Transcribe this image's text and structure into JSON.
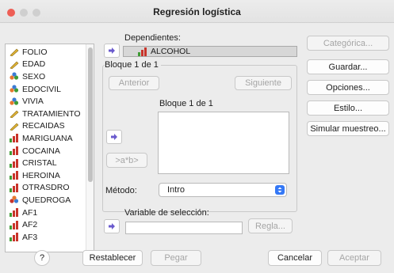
{
  "window": {
    "title": "Regresión logística",
    "controls": {
      "close": "#ee5e55",
      "minimize": "#f5be4f",
      "zoom": "#59c13f"
    }
  },
  "variables": [
    {
      "label": "FOLIO",
      "type": "scale"
    },
    {
      "label": "EDAD",
      "type": "scale"
    },
    {
      "label": "SEXO",
      "type": "nominal"
    },
    {
      "label": "EDOCIVIL",
      "type": "nominal"
    },
    {
      "label": "VIVIA",
      "type": "nominal"
    },
    {
      "label": "TRATAMIENTO",
      "type": "scale"
    },
    {
      "label": "RECAIDAS",
      "type": "scale"
    },
    {
      "label": "MARIGUANA",
      "type": "ordinal"
    },
    {
      "label": "COCAINA",
      "type": "ordinal"
    },
    {
      "label": "CRISTAL",
      "type": "ordinal"
    },
    {
      "label": "HEROINA",
      "type": "ordinal"
    },
    {
      "label": "OTRASDRO",
      "type": "ordinal"
    },
    {
      "label": "QUEDROGA",
      "type": "nominal-alt"
    },
    {
      "label": "AF1",
      "type": "ordinal"
    },
    {
      "label": "AF2",
      "type": "ordinal"
    },
    {
      "label": "AF3",
      "type": "ordinal"
    }
  ],
  "dependent": {
    "label": "Dependientes:",
    "value": "ALCOHOL",
    "value_icon": "ordinal"
  },
  "block": {
    "header": "Bloque 1 de 1",
    "prev_label": "Anterior",
    "next_label": "Siguiente",
    "inner_label": "Bloque 1 de 1",
    "interaction_label": ">a*b>"
  },
  "method": {
    "label": "Método:",
    "value": "Intro"
  },
  "selection": {
    "label": "Variable de selección:",
    "rule_label": "Regla..."
  },
  "side_buttons": {
    "categoria": "Categórica...",
    "guardar": "Guardar...",
    "opciones": "Opciones...",
    "estilo": "Estilo...",
    "simular": "Simular muestreo..."
  },
  "footer": {
    "help": "?",
    "restablecer": "Restablecer",
    "pegar": "Pegar",
    "cancelar": "Cancelar",
    "aceptar": "Aceptar"
  },
  "icons": {
    "move_arrow": "right-arrow-icon",
    "scale": "ruler-icon",
    "nominal": "nominal-circles-icon",
    "ordinal": "ordinal-bars-icon"
  },
  "colors": {
    "arrow_purple": "#6a5acd",
    "bar_red": "#c8342a",
    "bar_green": "#3f9b35",
    "ruler_yellow": "#e0b436",
    "select_blue": "#3478f6"
  }
}
